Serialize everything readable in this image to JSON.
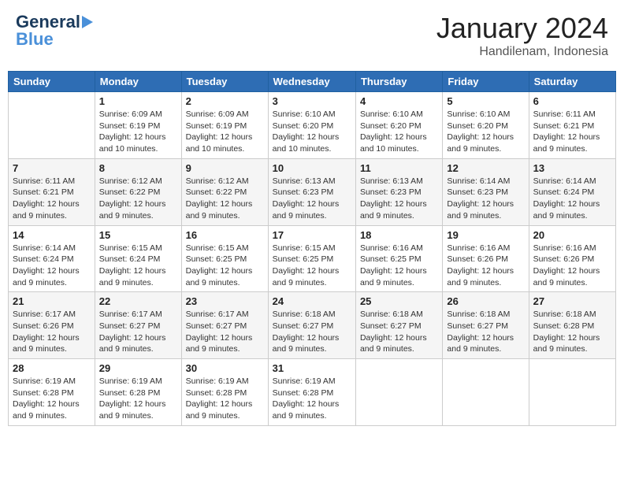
{
  "header": {
    "logo_general": "General",
    "logo_blue": "Blue",
    "month_title": "January 2024",
    "location": "Handilenam, Indonesia"
  },
  "days_of_week": [
    "Sunday",
    "Monday",
    "Tuesday",
    "Wednesday",
    "Thursday",
    "Friday",
    "Saturday"
  ],
  "weeks": [
    [
      {
        "day": "",
        "info": ""
      },
      {
        "day": "1",
        "info": "Sunrise: 6:09 AM\nSunset: 6:19 PM\nDaylight: 12 hours\nand 10 minutes."
      },
      {
        "day": "2",
        "info": "Sunrise: 6:09 AM\nSunset: 6:19 PM\nDaylight: 12 hours\nand 10 minutes."
      },
      {
        "day": "3",
        "info": "Sunrise: 6:10 AM\nSunset: 6:20 PM\nDaylight: 12 hours\nand 10 minutes."
      },
      {
        "day": "4",
        "info": "Sunrise: 6:10 AM\nSunset: 6:20 PM\nDaylight: 12 hours\nand 10 minutes."
      },
      {
        "day": "5",
        "info": "Sunrise: 6:10 AM\nSunset: 6:20 PM\nDaylight: 12 hours\nand 9 minutes."
      },
      {
        "day": "6",
        "info": "Sunrise: 6:11 AM\nSunset: 6:21 PM\nDaylight: 12 hours\nand 9 minutes."
      }
    ],
    [
      {
        "day": "7",
        "info": "Sunrise: 6:11 AM\nSunset: 6:21 PM\nDaylight: 12 hours\nand 9 minutes."
      },
      {
        "day": "8",
        "info": "Sunrise: 6:12 AM\nSunset: 6:22 PM\nDaylight: 12 hours\nand 9 minutes."
      },
      {
        "day": "9",
        "info": "Sunrise: 6:12 AM\nSunset: 6:22 PM\nDaylight: 12 hours\nand 9 minutes."
      },
      {
        "day": "10",
        "info": "Sunrise: 6:13 AM\nSunset: 6:23 PM\nDaylight: 12 hours\nand 9 minutes."
      },
      {
        "day": "11",
        "info": "Sunrise: 6:13 AM\nSunset: 6:23 PM\nDaylight: 12 hours\nand 9 minutes."
      },
      {
        "day": "12",
        "info": "Sunrise: 6:14 AM\nSunset: 6:23 PM\nDaylight: 12 hours\nand 9 minutes."
      },
      {
        "day": "13",
        "info": "Sunrise: 6:14 AM\nSunset: 6:24 PM\nDaylight: 12 hours\nand 9 minutes."
      }
    ],
    [
      {
        "day": "14",
        "info": "Sunrise: 6:14 AM\nSunset: 6:24 PM\nDaylight: 12 hours\nand 9 minutes."
      },
      {
        "day": "15",
        "info": "Sunrise: 6:15 AM\nSunset: 6:24 PM\nDaylight: 12 hours\nand 9 minutes."
      },
      {
        "day": "16",
        "info": "Sunrise: 6:15 AM\nSunset: 6:25 PM\nDaylight: 12 hours\nand 9 minutes."
      },
      {
        "day": "17",
        "info": "Sunrise: 6:15 AM\nSunset: 6:25 PM\nDaylight: 12 hours\nand 9 minutes."
      },
      {
        "day": "18",
        "info": "Sunrise: 6:16 AM\nSunset: 6:25 PM\nDaylight: 12 hours\nand 9 minutes."
      },
      {
        "day": "19",
        "info": "Sunrise: 6:16 AM\nSunset: 6:26 PM\nDaylight: 12 hours\nand 9 minutes."
      },
      {
        "day": "20",
        "info": "Sunrise: 6:16 AM\nSunset: 6:26 PM\nDaylight: 12 hours\nand 9 minutes."
      }
    ],
    [
      {
        "day": "21",
        "info": "Sunrise: 6:17 AM\nSunset: 6:26 PM\nDaylight: 12 hours\nand 9 minutes."
      },
      {
        "day": "22",
        "info": "Sunrise: 6:17 AM\nSunset: 6:27 PM\nDaylight: 12 hours\nand 9 minutes."
      },
      {
        "day": "23",
        "info": "Sunrise: 6:17 AM\nSunset: 6:27 PM\nDaylight: 12 hours\nand 9 minutes."
      },
      {
        "day": "24",
        "info": "Sunrise: 6:18 AM\nSunset: 6:27 PM\nDaylight: 12 hours\nand 9 minutes."
      },
      {
        "day": "25",
        "info": "Sunrise: 6:18 AM\nSunset: 6:27 PM\nDaylight: 12 hours\nand 9 minutes."
      },
      {
        "day": "26",
        "info": "Sunrise: 6:18 AM\nSunset: 6:27 PM\nDaylight: 12 hours\nand 9 minutes."
      },
      {
        "day": "27",
        "info": "Sunrise: 6:18 AM\nSunset: 6:28 PM\nDaylight: 12 hours\nand 9 minutes."
      }
    ],
    [
      {
        "day": "28",
        "info": "Sunrise: 6:19 AM\nSunset: 6:28 PM\nDaylight: 12 hours\nand 9 minutes."
      },
      {
        "day": "29",
        "info": "Sunrise: 6:19 AM\nSunset: 6:28 PM\nDaylight: 12 hours\nand 9 minutes."
      },
      {
        "day": "30",
        "info": "Sunrise: 6:19 AM\nSunset: 6:28 PM\nDaylight: 12 hours\nand 9 minutes."
      },
      {
        "day": "31",
        "info": "Sunrise: 6:19 AM\nSunset: 6:28 PM\nDaylight: 12 hours\nand 9 minutes."
      },
      {
        "day": "",
        "info": ""
      },
      {
        "day": "",
        "info": ""
      },
      {
        "day": "",
        "info": ""
      }
    ]
  ]
}
